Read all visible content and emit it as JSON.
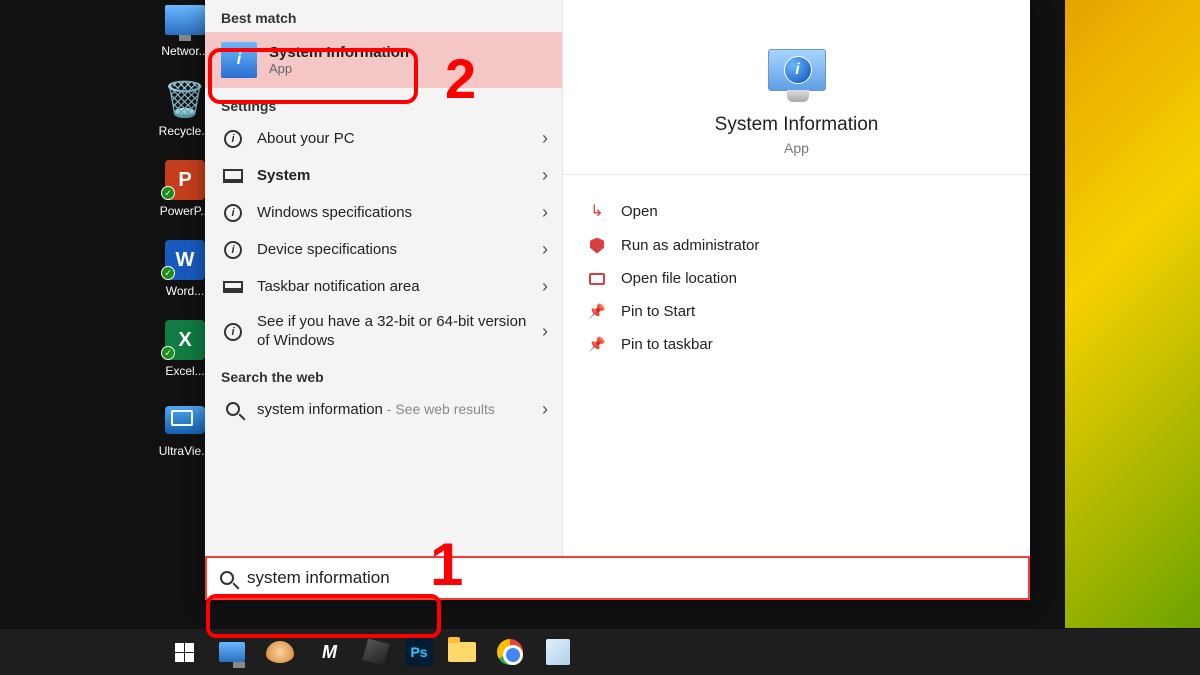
{
  "desktop": {
    "icons": [
      {
        "label": "Networ...",
        "kind": "network"
      },
      {
        "label": "Recycle...",
        "kind": "recycle"
      },
      {
        "label": "PowerP...",
        "kind": "ppt",
        "letter": "P"
      },
      {
        "label": "Word...",
        "kind": "word",
        "letter": "W"
      },
      {
        "label": "Excel...",
        "kind": "excel",
        "letter": "X"
      },
      {
        "label": "UltraVie...",
        "kind": "ultra"
      }
    ]
  },
  "search": {
    "sections": {
      "best_match": "Best match",
      "settings": "Settings",
      "web": "Search the web"
    },
    "best_match": {
      "title": "System Information",
      "subtitle": "App"
    },
    "settings_items": [
      {
        "icon": "info",
        "label": "About your PC"
      },
      {
        "icon": "monitor",
        "label": "System",
        "bold": true
      },
      {
        "icon": "info",
        "label": "Windows specifications"
      },
      {
        "icon": "info",
        "label": "Device specifications"
      },
      {
        "icon": "taskbar",
        "label": "Taskbar notification area"
      },
      {
        "icon": "info",
        "label": "See if you have a 32-bit or 64-bit version of Windows"
      }
    ],
    "web_item": {
      "label": "system information",
      "suffix": " - See web results"
    },
    "input_value": "system information"
  },
  "detail": {
    "title": "System Information",
    "subtitle": "App",
    "actions": [
      {
        "icon": "open",
        "label": "Open"
      },
      {
        "icon": "admin",
        "label": "Run as administrator"
      },
      {
        "icon": "folder",
        "label": "Open file location"
      },
      {
        "icon": "pin",
        "label": "Pin to Start"
      },
      {
        "icon": "pin",
        "label": "Pin to taskbar"
      }
    ]
  },
  "annotations": {
    "one": "1",
    "two": "2"
  },
  "taskbar": {
    "items": [
      "start",
      "assist",
      "paint",
      "ma",
      "cube",
      "ps",
      "folder",
      "chrome",
      "note"
    ]
  }
}
